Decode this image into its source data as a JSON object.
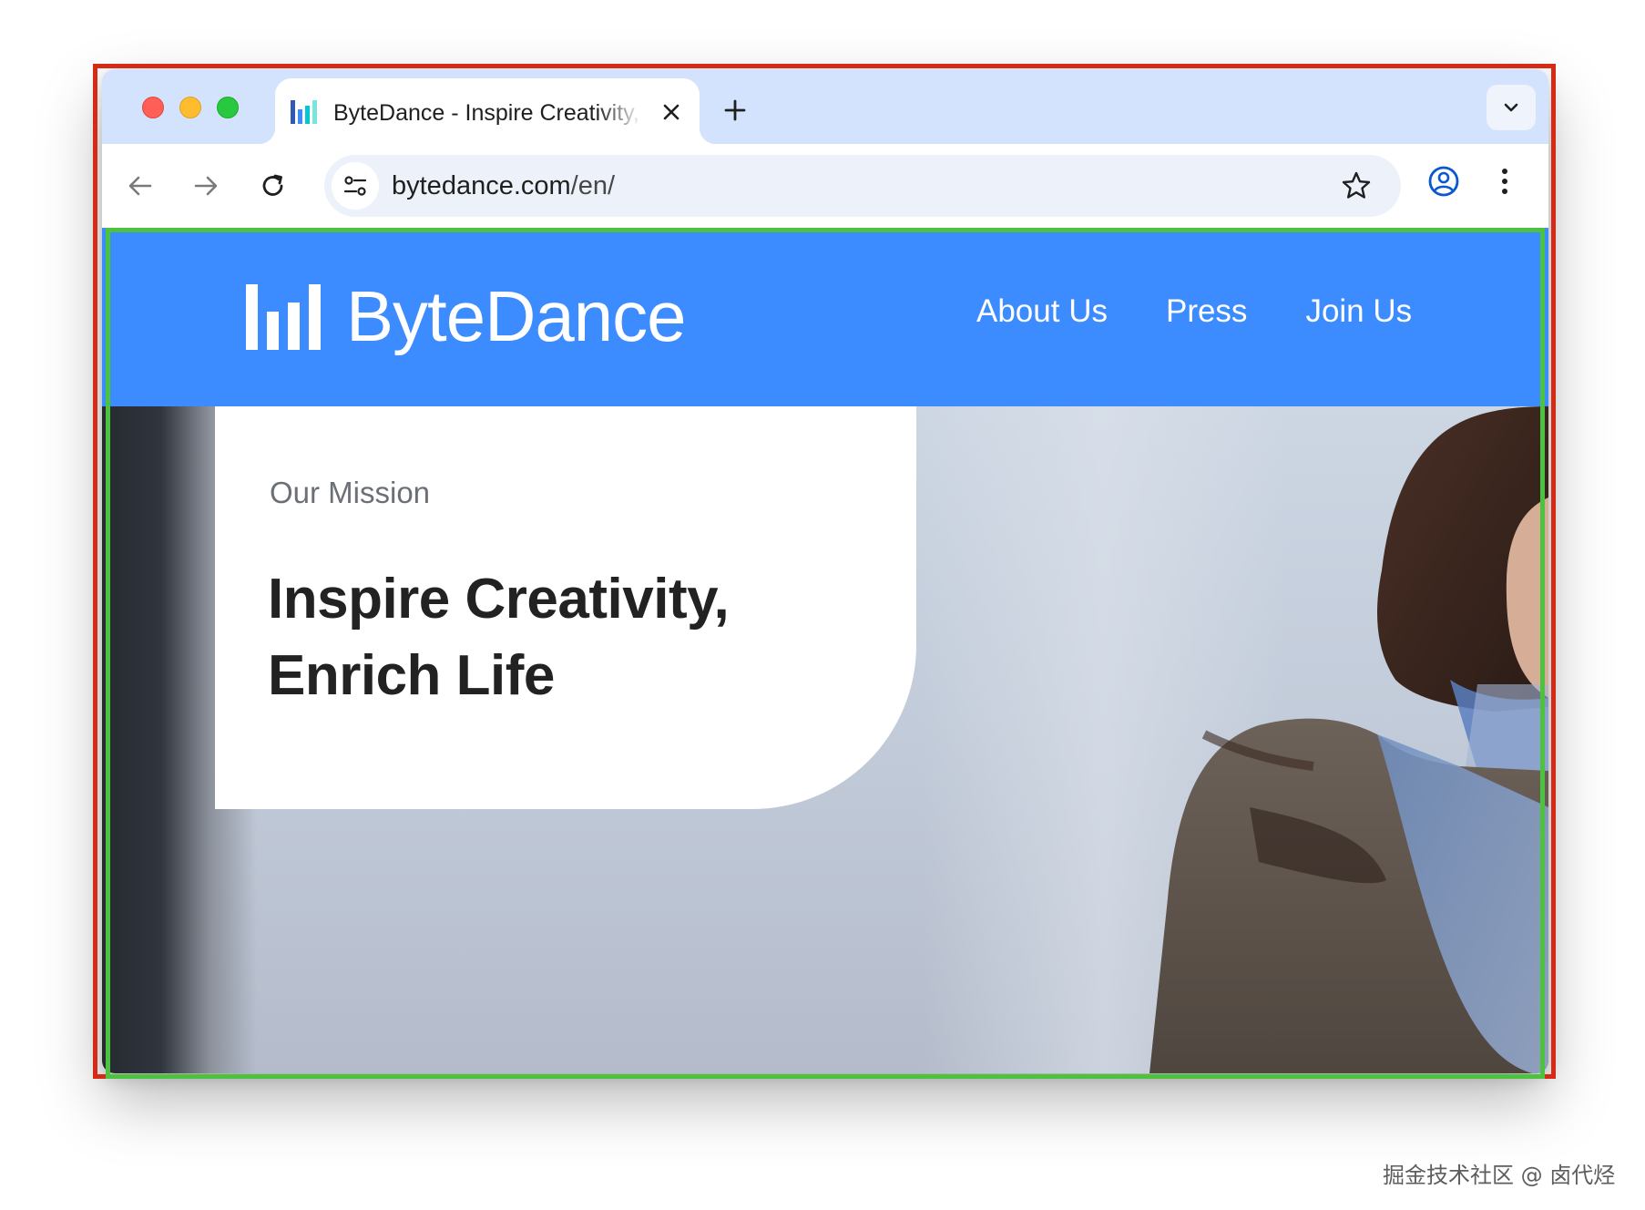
{
  "browser": {
    "window_controls": [
      "close",
      "minimize",
      "zoom"
    ],
    "tab": {
      "title": "ByteDance - Inspire Creativity, Enrich Life",
      "favicon": "bytedance-logo-icon",
      "close_icon": "close-icon"
    },
    "new_tab_icon": "plus-icon",
    "tab_search_icon": "chevron-down-icon",
    "toolbar": {
      "back_icon": "arrow-left-icon",
      "forward_icon": "arrow-right-icon",
      "reload_icon": "reload-icon",
      "site_info_icon": "tune-icon",
      "url_host": "bytedance.com",
      "url_path": "/en/",
      "bookmark_icon": "star-icon",
      "profile_icon": "profile-icon",
      "menu_icon": "more-vertical-icon"
    }
  },
  "site": {
    "brand_name": "ByteDance",
    "logo_icon": "bytedance-bars-logo",
    "nav": [
      "About Us",
      "Press",
      "Join Us"
    ],
    "hero": {
      "kicker": "Our Mission",
      "title_line1": "Inspire Creativity,",
      "title_line2": "Enrich Life"
    }
  },
  "watermark": "掘金技术社区 @ 卤代烃",
  "colors": {
    "header_bg": "#3c8cff",
    "chrome_frame": "#d3e3fd",
    "annotation_red": "#d42a16",
    "annotation_green": "#4cc23f"
  }
}
